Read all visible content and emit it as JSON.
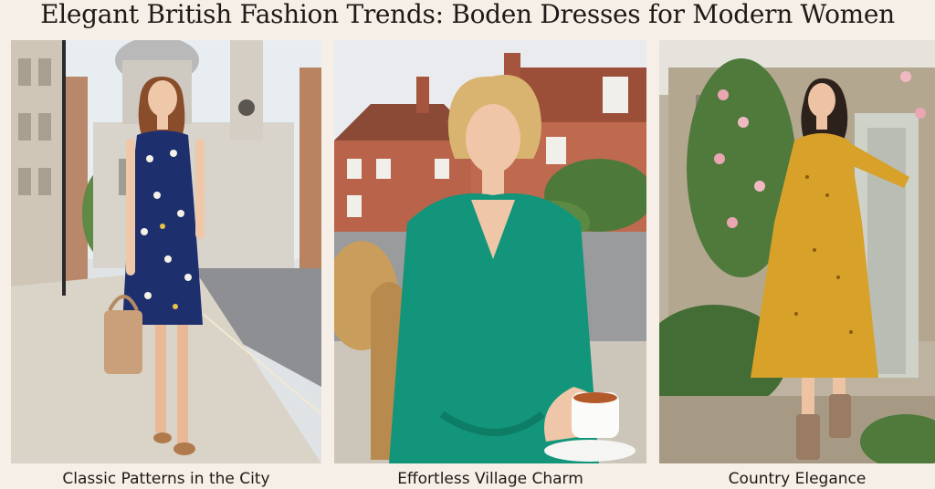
{
  "title": "Elegant British Fashion Trends: Boden Dresses for Modern Women",
  "panels": [
    {
      "caption": "Classic Patterns in the City",
      "dress_color": "#1e2f6e",
      "scene": "city-street"
    },
    {
      "caption": "Effortless Village Charm",
      "dress_color": "#12957a",
      "scene": "village-cafe"
    },
    {
      "caption": "Country Elegance",
      "dress_color": "#d7a12a",
      "scene": "country-cottage"
    }
  ]
}
